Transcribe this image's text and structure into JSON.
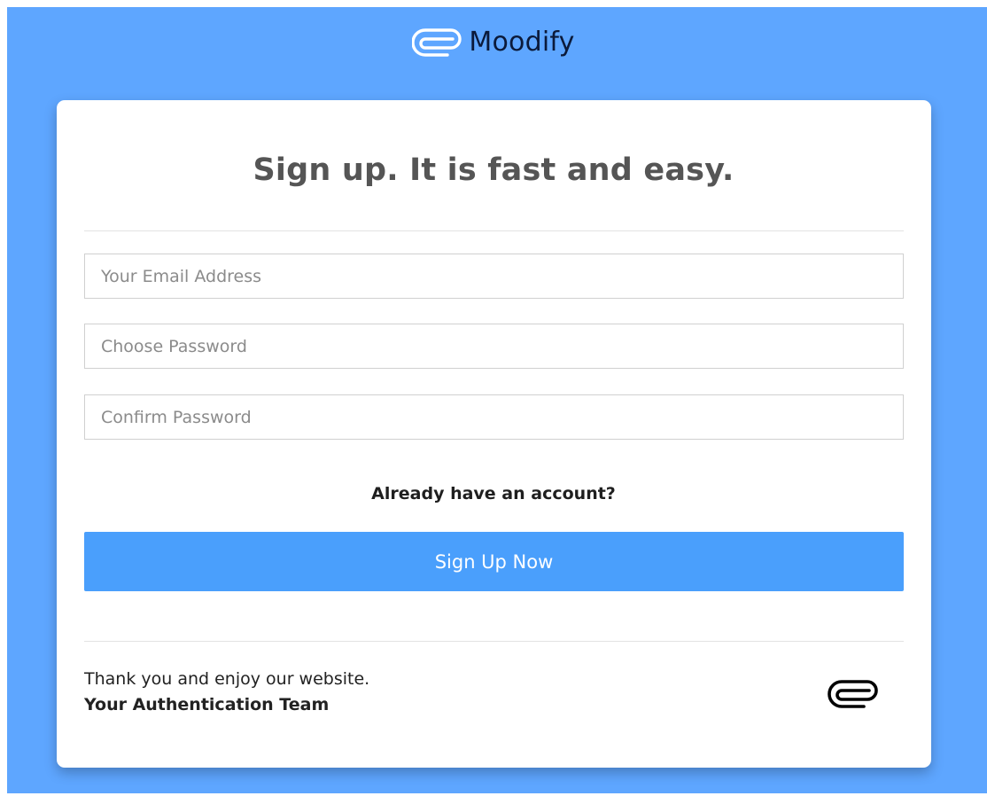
{
  "brand": {
    "name": "Moodify",
    "icon": "paperclip-logo-icon",
    "icon_color": "#ffffff"
  },
  "form": {
    "title": "Sign up. It is fast and easy.",
    "email_placeholder": "Your Email Address",
    "password_placeholder": "Choose Password",
    "confirm_placeholder": "Confirm Password",
    "email_value": "",
    "password_value": "",
    "confirm_value": "",
    "login_link": "Already have an account?",
    "submit_label": "Sign Up Now"
  },
  "footer": {
    "message": "Thank you and enjoy our website.",
    "team": "Your Authentication Team",
    "icon": "paperclip-icon"
  },
  "colors": {
    "background": "#5ea6ff",
    "accent": "#4a9ffc",
    "card": "#ffffff",
    "title": "#555555"
  }
}
